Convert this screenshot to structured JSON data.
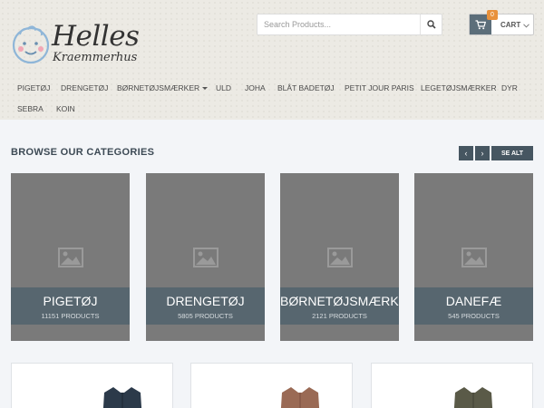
{
  "brand": {
    "title": "Helles",
    "subtitle": "Kraemmerhus"
  },
  "search": {
    "placeholder": "Search Products..."
  },
  "cart": {
    "label": "CART",
    "count": "0"
  },
  "nav": {
    "items": [
      {
        "label": "PIGETØJ"
      },
      {
        "label": "DRENGETØJ"
      },
      {
        "label": "BØRNETØJSMÆRKER"
      },
      {
        "label": "ULD"
      },
      {
        "label": "JOHA"
      },
      {
        "label": "BLÅT BADETØJ"
      },
      {
        "label": "PETIT JOUR PARIS"
      },
      {
        "label": "LEGETØJSMÆRKER"
      },
      {
        "label": "DYR"
      },
      {
        "label": "SEBRA"
      },
      {
        "label": "KOIN"
      }
    ]
  },
  "browse": {
    "title": "BROWSE OUR CATEGORIES",
    "prev": "‹",
    "next": "›",
    "see_all": "SE ALT"
  },
  "categories": [
    {
      "name": "PIGETØJ",
      "count": "11151 PRODUCTS"
    },
    {
      "name": "DRENGETØJ",
      "count": "5805 PRODUCTS"
    },
    {
      "name": "BØRNETØJSMÆRKE",
      "count": "2121 PRODUCTS"
    },
    {
      "name": "DANEFÆ",
      "count": "545 PRODUCTS"
    }
  ],
  "colors": {
    "accent": "#465661",
    "badge": "#e8913c",
    "category_band": "#57666f",
    "product_colors": [
      "#2c3a4a",
      "#9a6a55",
      "#5a5a48"
    ]
  },
  "icons": {
    "search": "search-icon",
    "cart": "cart-icon",
    "image_placeholder": "image-placeholder-icon"
  }
}
